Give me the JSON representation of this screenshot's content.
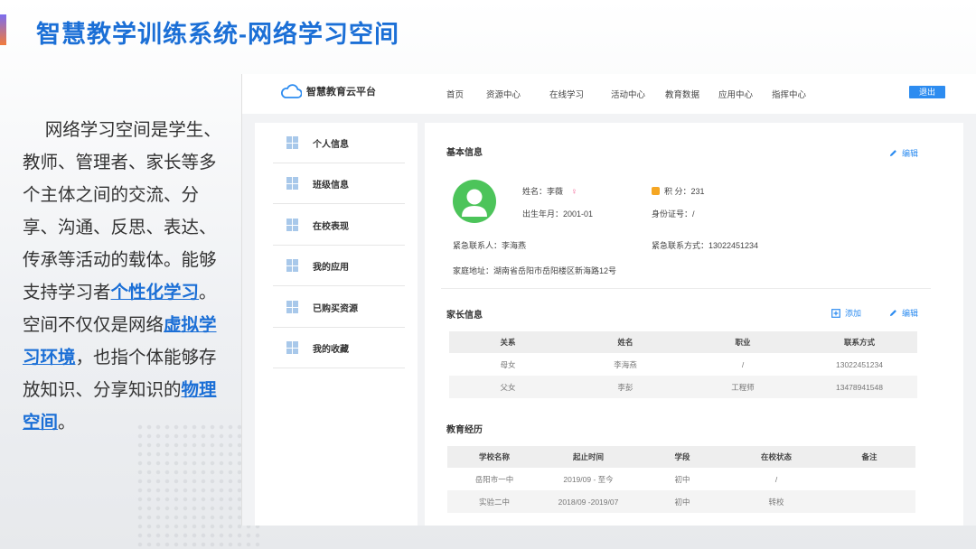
{
  "slide": {
    "title": "智慧教学训练系统-网络学习空间",
    "intro": {
      "p1": "网络学习空间是学生、教师、管理者、家长等多个主体之间的交流、分享、沟通、反思、表达、传承等活动的载体。能够支持学习者",
      "hl1": "个性化学习",
      "p2": "。空间不仅仅是网络",
      "hl2": "虚拟学习环境",
      "p3": "，也指个体能够存放知识、分享知识的",
      "hl3": "物理空间",
      "p4": "。"
    },
    "accent_colors": [
      "#7b6cf0",
      "#f27b3c"
    ],
    "title_color": "#1b6fd6"
  },
  "app": {
    "logo_text": "智慧教育云平台",
    "logo_icon": "cloud-icon",
    "nav": [
      "首页",
      "资源中心",
      "在线学习",
      "活动中心",
      "教育数据",
      "应用中心",
      "指挥中心"
    ],
    "logout": "退出",
    "accent": "#2d8cf0",
    "sidebar": [
      {
        "label": "个人信息",
        "icon": "windows-icon"
      },
      {
        "label": "班级信息",
        "icon": "windows-icon"
      },
      {
        "label": "在校表现",
        "icon": "windows-icon"
      },
      {
        "label": "我的应用",
        "icon": "windows-icon"
      },
      {
        "label": "已购买资源",
        "icon": "windows-icon"
      },
      {
        "label": "我的收藏",
        "icon": "windows-icon"
      }
    ],
    "basic": {
      "title": "基本信息",
      "edit": "编辑",
      "name": "姓名：李薇",
      "birth": "出生年月：2001-01",
      "points": "积 分：231",
      "id_no": "身份证号：/",
      "emergency_contact": "紧急联系人：李海燕",
      "emergency_phone": "紧急联系方式：13022451234",
      "address": "家庭地址：湖南省岳阳市岳阳楼区新海路12号"
    },
    "parents": {
      "title": "家长信息",
      "add": "添加",
      "edit": "编辑",
      "headers": [
        "关系",
        "姓名",
        "职业",
        "联系方式"
      ],
      "rows": [
        [
          "母女",
          "李海燕",
          "/",
          "13022451234"
        ],
        [
          "父女",
          "李彭",
          "工程师",
          "13478941548"
        ]
      ]
    },
    "education": {
      "title": "教育经历",
      "headers": [
        "学校名称",
        "起止时间",
        "学段",
        "在校状态",
        "备注"
      ],
      "rows": [
        [
          "岳阳市一中",
          "2019/09 - 至今",
          "初中",
          "/",
          ""
        ],
        [
          "实验二中",
          "2018/09 -2019/07",
          "初中",
          "转校",
          ""
        ]
      ]
    }
  }
}
